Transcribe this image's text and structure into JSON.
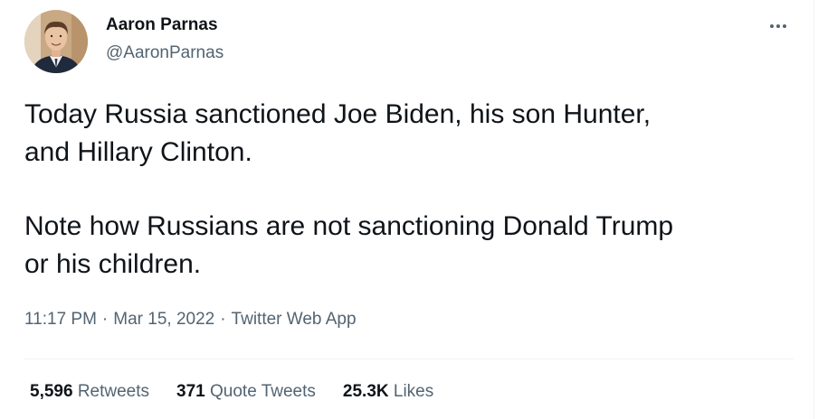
{
  "author": {
    "name": "Aaron Parnas",
    "handle": "@AaronParnas",
    "avatar_icon": "profile-photo"
  },
  "tweet": {
    "paragraphs": [
      [
        "Today Russia sanctioned Joe Biden, his son Hunter,",
        "and Hillary Clinton."
      ],
      [
        "Note how Russians are not sanctioning Donald Trump",
        "or his children."
      ]
    ]
  },
  "meta": {
    "time": "11:17 PM",
    "date": "Mar 15, 2022",
    "source": "Twitter Web App",
    "separator": "·"
  },
  "stats": [
    {
      "count": "5,596",
      "label": "Retweets"
    },
    {
      "count": "371",
      "label": "Quote Tweets"
    },
    {
      "count": "25.3K",
      "label": "Likes"
    }
  ],
  "more_icon": "more-horizontal-icon",
  "colors": {
    "text_primary": "#0f1419",
    "text_secondary": "#536471",
    "divider": "#eff3f4"
  }
}
